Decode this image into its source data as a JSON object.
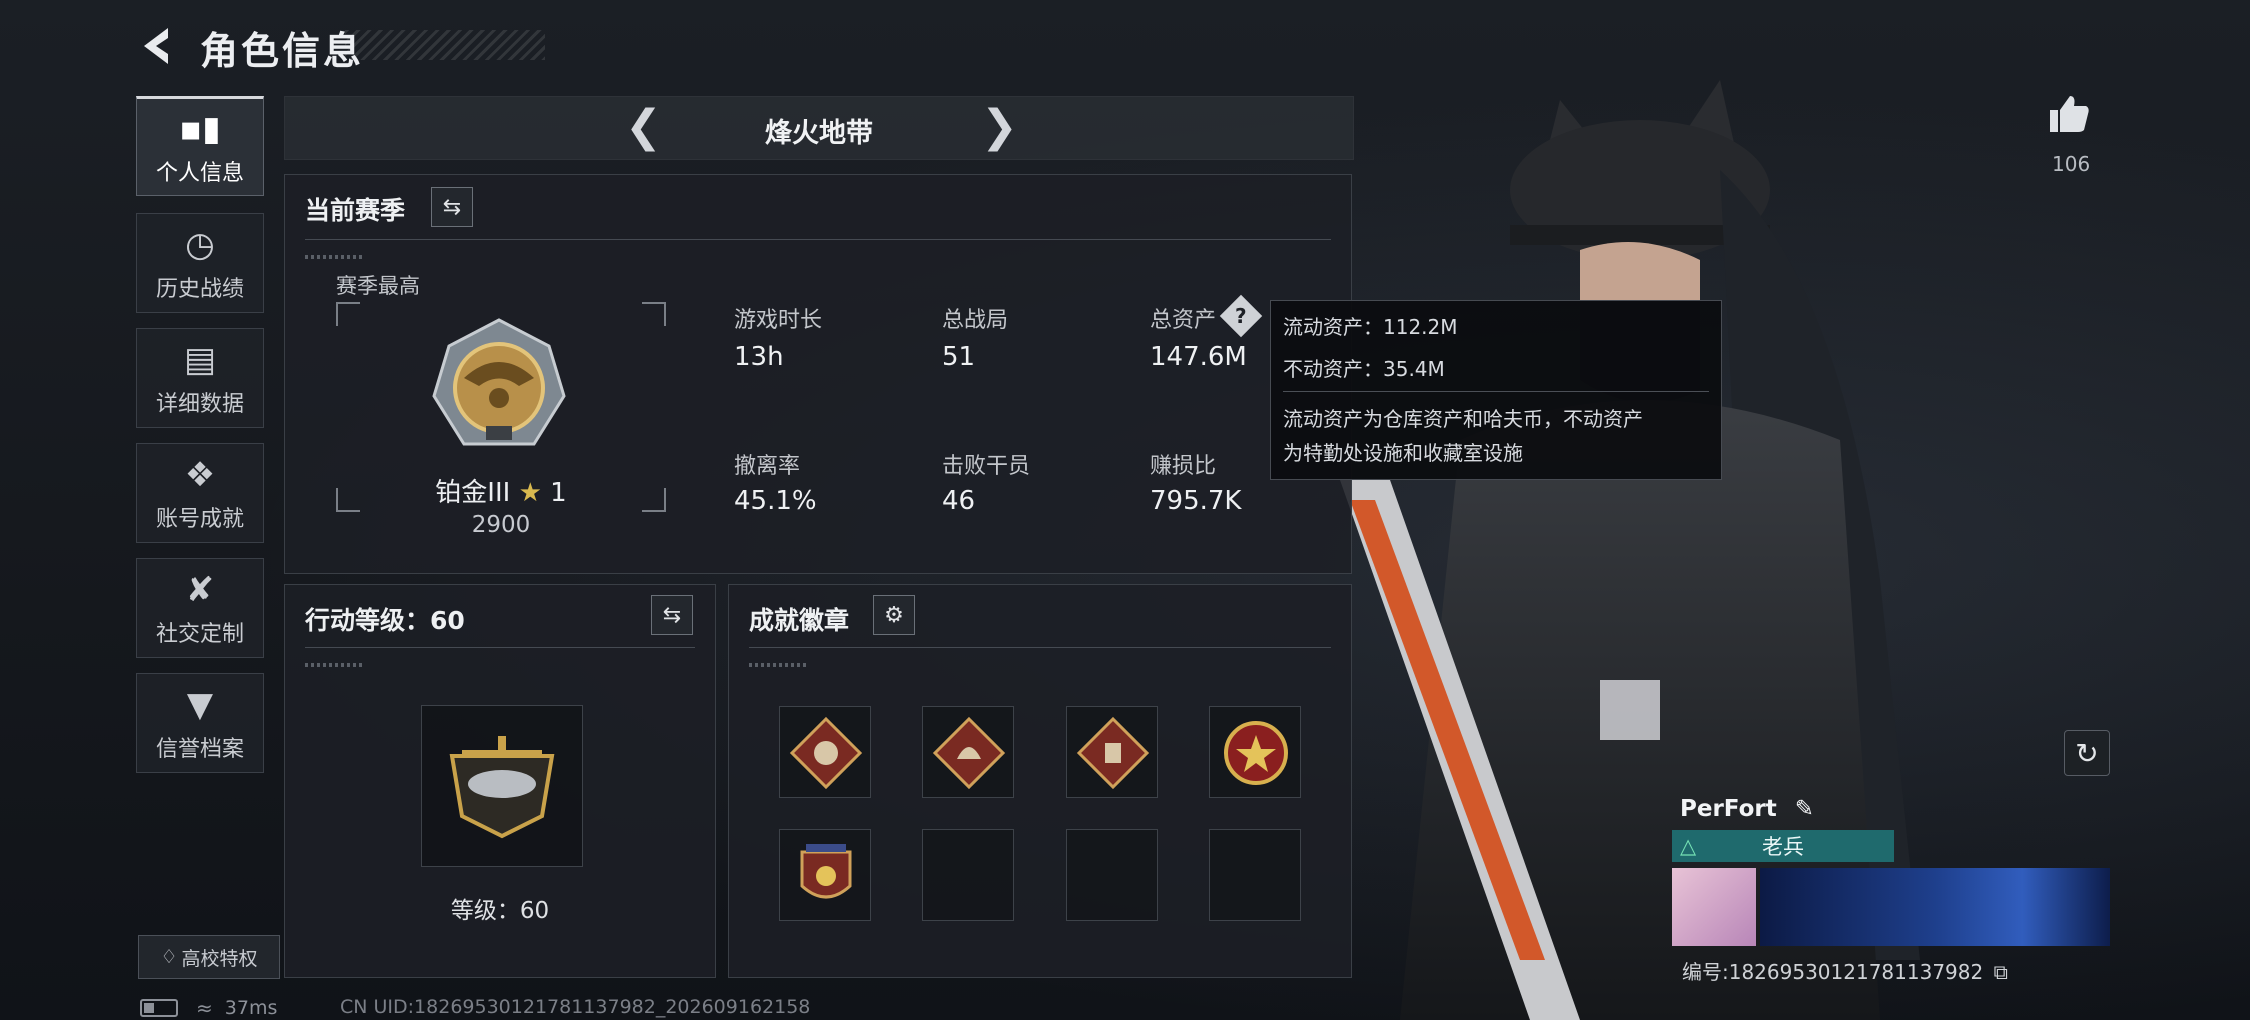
{
  "header": {
    "title": "角色信息"
  },
  "sidebar": {
    "items": [
      {
        "label": "个人信息",
        "icon": "bar-chart-icon"
      },
      {
        "label": "历史战绩",
        "icon": "history-clock-icon"
      },
      {
        "label": "详细数据",
        "icon": "folder-icon"
      },
      {
        "label": "账号成就",
        "icon": "achievement-icon"
      },
      {
        "label": "社交定制",
        "icon": "tools-icon"
      },
      {
        "label": "信誉档案",
        "icon": "reputation-icon"
      }
    ],
    "campus_label": "高校特权"
  },
  "mode": {
    "title": "烽火地带"
  },
  "season": {
    "title": "当前赛季",
    "best_label": "赛季最高",
    "rank_name": "铂金III",
    "rank_stars": "1",
    "rank_score": "2900",
    "stats": [
      {
        "label": "游戏时长",
        "value": "13h"
      },
      {
        "label": "总战局",
        "value": "51"
      },
      {
        "label": "总资产",
        "value": "147.6M"
      },
      {
        "label": "撤离率",
        "value": "45.1%"
      },
      {
        "label": "击败干员",
        "value": "46"
      },
      {
        "label": "赚损比",
        "value": "795.7K"
      }
    ]
  },
  "tooltip": {
    "liquid": "流动资产：112.2M",
    "fixed": "不动资产：35.4M",
    "desc_line1": "流动资产为仓库资产和哈夫币，不动资产",
    "desc_line2": "为特勤处设施和收藏室设施"
  },
  "action_level": {
    "title": "行动等级：60",
    "level_text": "等级：60"
  },
  "achievements": {
    "title": "成就徽章"
  },
  "profile": {
    "like_count": "106",
    "player_name": "PerFort",
    "rank_tag": "老兵",
    "id_text": "编号:1826953012178113798​2"
  },
  "status_bar": {
    "ping": "37ms",
    "uid_text": "CN UID:1826953012178113798​2_202609162158"
  },
  "colors": {
    "accent_teal": "#1f6a6d",
    "panel_bg": "#1c1f25",
    "gold": "#c9a24a"
  }
}
